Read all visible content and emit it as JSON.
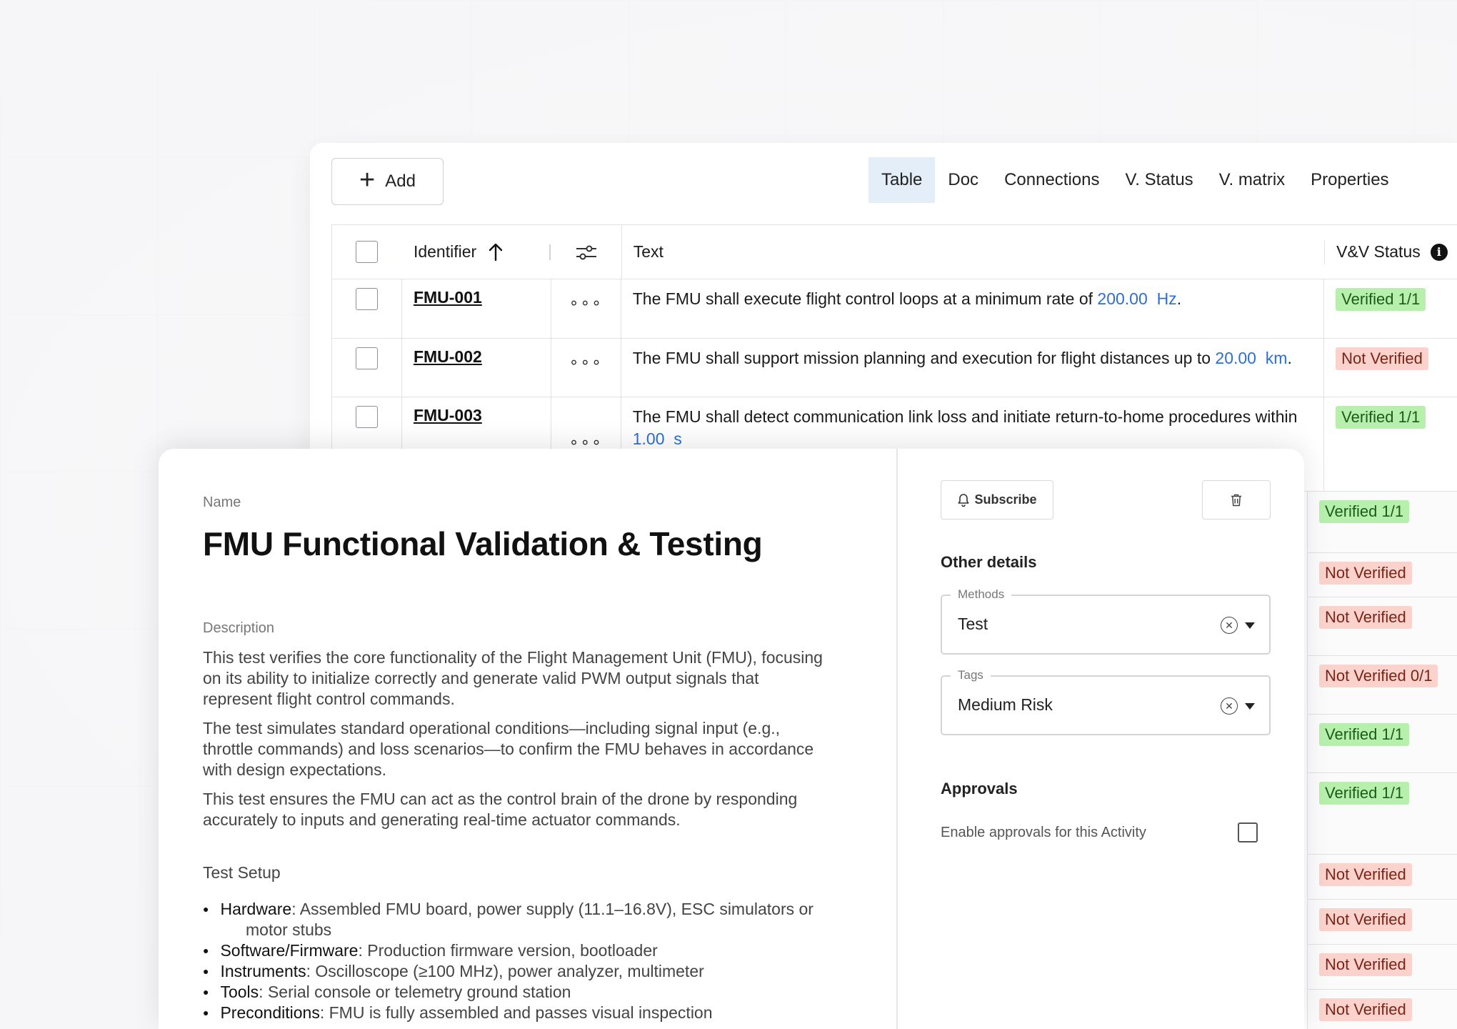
{
  "toolbar": {
    "add_label": "Add",
    "tabs": [
      {
        "label": "Table",
        "active": true
      },
      {
        "label": "Doc",
        "active": false
      },
      {
        "label": "Connections",
        "active": false
      },
      {
        "label": "V. Status",
        "active": false
      },
      {
        "label": "V. matrix",
        "active": false
      },
      {
        "label": "Properties",
        "active": false
      }
    ]
  },
  "table": {
    "columns": {
      "identifier": "Identifier",
      "text": "Text",
      "status": "V&V Status"
    },
    "rows": [
      {
        "id": "FMU-001",
        "text_before": "The FMU shall execute flight control loops at a minimum rate of ",
        "qty_value": "200.00",
        "qty_unit": "Hz",
        "text_after": ".",
        "status": "Verified 1/1",
        "status_kind": "ok"
      },
      {
        "id": "FMU-002",
        "text_before": "The FMU shall support mission planning and execution for flight distances up to ",
        "qty_value": "20.00",
        "qty_unit": "km",
        "text_after": ".",
        "status": "Not Verified",
        "status_kind": "no"
      },
      {
        "id": "FMU-003",
        "text_before": "The FMU shall detect communication link loss and initiate return-to-home procedures within ",
        "qty_value": "1.00",
        "qty_unit": "s",
        "text_after": "",
        "status": "Verified 1/1",
        "status_kind": "ok"
      }
    ],
    "more_statuses": [
      {
        "label": "Verified 1/1",
        "kind": "ok"
      },
      {
        "label": "Not Verified",
        "kind": "no"
      },
      {
        "label": "Not Verified",
        "kind": "no"
      },
      {
        "label": "Not Verified 0/1",
        "kind": "no"
      },
      {
        "label": "Verified 1/1",
        "kind": "ok"
      },
      {
        "label": "Verified 1/1",
        "kind": "ok"
      },
      {
        "label": "Not Verified",
        "kind": "no"
      },
      {
        "label": "Not Verified",
        "kind": "no"
      },
      {
        "label": "Not Verified",
        "kind": "no"
      },
      {
        "label": "Not Verified",
        "kind": "no"
      }
    ]
  },
  "detail": {
    "name_label": "Name",
    "title": "FMU Functional Validation & Testing",
    "description_label": "Description",
    "description": [
      "This test verifies the core functionality of the Flight Management Unit (FMU), focusing on its ability to initialize correctly and generate valid PWM output signals that represent flight control commands.",
      "The test simulates standard operational conditions—including signal input (e.g., throttle commands) and loss scenarios—to confirm the FMU behaves in accordance with design expectations.",
      "This test ensures the FMU can act as the control brain of the drone by responding accurately to inputs and generating real-time actuator commands."
    ],
    "setup_label": "Test Setup",
    "setup_items": [
      {
        "key": "Hardware",
        "value": ": Assembled FMU board, power supply (11.1–16.8V), ESC simulators or motor stubs"
      },
      {
        "key": "Software/Firmware",
        "value": ": Production firmware version, bootloader"
      },
      {
        "key": "Instruments",
        "value": ": Oscilloscope (≥100 MHz), power analyzer, multimeter"
      },
      {
        "key": "Tools",
        "value": ": Serial console or telemetry ground station"
      },
      {
        "key": "Preconditions",
        "value": ": FMU is fully assembled and passes visual inspection"
      }
    ],
    "subscribe_label": "Subscribe",
    "other_details_title": "Other details",
    "methods": {
      "legend": "Methods",
      "value": "Test"
    },
    "tags": {
      "legend": "Tags",
      "value": "Medium Risk"
    },
    "approvals_title": "Approvals",
    "approvals_text": "Enable approvals for this Activity"
  }
}
